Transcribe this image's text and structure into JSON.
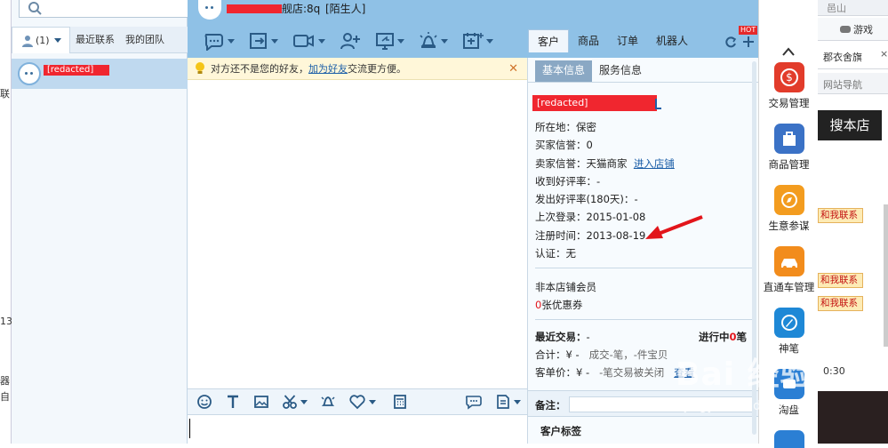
{
  "left_strip": {
    "labels": [
      "联",
      "13",
      "器",
      "自"
    ]
  },
  "contacts": {
    "tabs": [
      {
        "label": "(1)"
      },
      {
        "label": "最近联系"
      },
      {
        "label": "我的团队"
      }
    ],
    "selected_contact": {
      "name": "[redacted]"
    }
  },
  "chat_header": {
    "title": "舰店:8q",
    "stranger_tag": "[陌生人]",
    "crm_tabs": [
      {
        "label": "客户"
      },
      {
        "label": "商品"
      },
      {
        "label": "订单"
      },
      {
        "label": "机器人"
      }
    ],
    "hot_badge": "HOT"
  },
  "notice": {
    "prefix": "对方还不是您的好友，",
    "link": "加为好友",
    "suffix": "交流更方便。"
  },
  "profile": {
    "tabs": [
      {
        "label": "基本信息"
      },
      {
        "label": "服务信息"
      }
    ],
    "name": "[redacted]",
    "location_label": "所在地：",
    "location_value": "保密",
    "buyer_label": "买家信誉：",
    "buyer_value": "0",
    "seller_label": "卖家信誉：",
    "seller_value": "天猫商家",
    "shop_link": "进入店铺",
    "received_label": "收到好评率：",
    "received_value": "-",
    "given_label": "发出好评率(180天)：",
    "given_value": "-",
    "last_login_label": "上次登录：",
    "last_login_value": "2015-01-08",
    "register_label": "注册时间：",
    "register_value": "2013-08-19",
    "verify_label": "认证：",
    "verify_value": "无",
    "member_status": "非本店铺会员",
    "coupon_count": "0",
    "coupon_suffix": "张优惠券",
    "recent_trade_label": "最近交易：",
    "recent_trade_value": "-",
    "in_progress_prefix": "进行中",
    "in_progress_count": "0",
    "in_progress_suffix": "笔",
    "total_label": "合计：",
    "total_value": "¥ -",
    "total_detail": "成交-笔，-件宝贝",
    "unit_price_label": "客单价：",
    "unit_price_value": "¥ -",
    "unit_price_detail": "-笔交易被关闭",
    "view_link": "查看",
    "note_label": "备注：",
    "customer_tags_label": "客户标签"
  },
  "app_bar": {
    "items": [
      {
        "label": "交易管理",
        "color": "#e23c2b"
      },
      {
        "label": "商品管理",
        "color": "#3b72c6"
      },
      {
        "label": "生意参谋",
        "color": "#f39c1f"
      },
      {
        "label": "直通车管理",
        "color": "#f28c1c"
      },
      {
        "label": "神笔",
        "color": "#1e88d6"
      },
      {
        "label": "淘盘",
        "color": "#2b7fd4"
      }
    ]
  },
  "browser": {
    "top_text": "邑山",
    "game_label": "游戏",
    "tab_label": "郡衣舍旗",
    "nav_label": "网站导航",
    "search_button": "搜本店",
    "contact_tags": [
      "和我联系",
      "和我联系",
      "和我联系"
    ],
    "time_text": "0:30"
  },
  "watermark": {
    "brand": "Bai 经验",
    "sub": "jingyan.baidu.com"
  }
}
